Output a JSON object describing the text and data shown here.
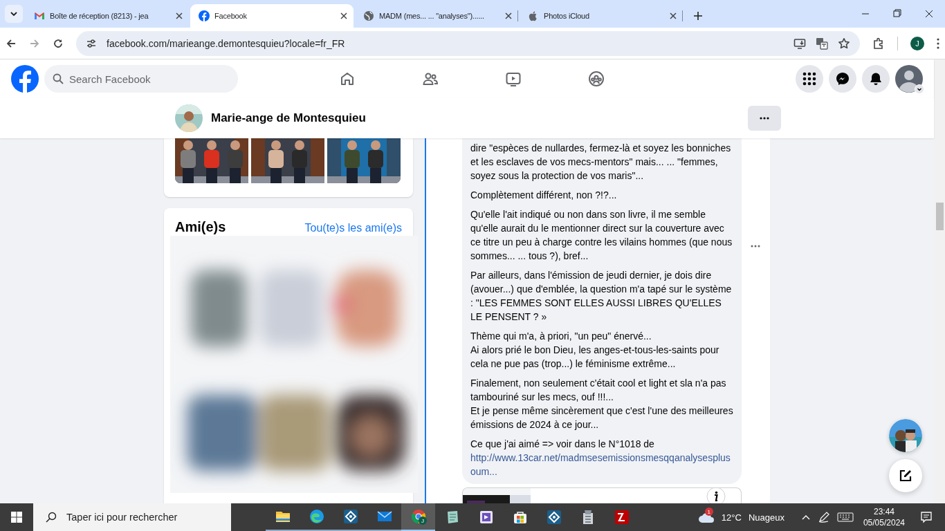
{
  "browser": {
    "tabs": [
      {
        "kind": "gmail",
        "title": "Boîte de réception (8213) - jea",
        "selected": false
      },
      {
        "kind": "facebook",
        "title": "Facebook",
        "selected": true
      },
      {
        "kind": "globe",
        "title": "MADM (mes... ... \"analyses\")......",
        "selected": false
      },
      {
        "kind": "apple",
        "title": "Photos iCloud",
        "selected": false
      }
    ],
    "url": "facebook.com/marieange.demontesquieu?locale=fr_FR",
    "profile_initial": "J"
  },
  "facebook": {
    "search_placeholder": "Search Facebook",
    "nav": [
      {
        "kind": "home"
      },
      {
        "kind": "friends"
      },
      {
        "kind": "video"
      },
      {
        "kind": "groups"
      }
    ]
  },
  "profile": {
    "name": "Marie-ange de Montesquieu"
  },
  "friends": {
    "title": "Ami(e)s",
    "link": "Tou(te)s les ami(e)s"
  },
  "comment": {
    "paragraphs": [
      "dire \"espèces de nullardes, fermez-là et soyez les bonniches et les esclaves de vos mecs-mentors\" mais... ... \"femmes, soyez sous la protection de vos maris\"...",
      "Complètement différent, non ?!?...",
      "Qu'elle l'ait indiqué ou non dans son livre, il me semble qu'elle aurait du le mentionner direct sur la couverture avec ce titre un peu à charge contre les vilains hommes (que nous sommes... ... tous ?), bref...",
      "Par ailleurs, dans l'émission de jeudi dernier, je dois dire (avouer...) que d'emblée, la question m'a tapé sur le système : \"LES FEMMES SONT ELLES AUSSI LIBRES QU'ELLES LE PENSENT ? »",
      "Thème qui m'a, à priori, \"un peu\" énervé...\nAi alors prié le bon Dieu, les anges-et-tous-les-saints pour cela ne pue pas (trop...) le féminisme extrême...",
      "Finalement, non seulement c'était cool et light et sla n'a pas tambouriné sur les mecs, ouf !!!...\nEt je pense même sincèrement que c'est l'une des meilleures émissions de 2024 à ce jour...",
      "Ce que j'ai aimé => voir dans le N°1018 de"
    ],
    "link": "http://www.13car.net/madmsesemissionsmesqqanalysesplusoum..."
  },
  "taskbar": {
    "search_placeholder": "Taper ici pour rechercher",
    "apps": [
      {
        "kind": "folder",
        "running": true,
        "selected": false
      },
      {
        "kind": "edge",
        "running": true,
        "selected": false
      },
      {
        "kind": "diamond",
        "running": true,
        "selected": false
      },
      {
        "kind": "mail",
        "running": true,
        "selected": false
      },
      {
        "kind": "chrome",
        "running": true,
        "selected": true,
        "badge": "J"
      },
      {
        "kind": "notepad",
        "running": false,
        "selected": false
      },
      {
        "kind": "studio",
        "running": false,
        "selected": false
      },
      {
        "kind": "store",
        "running": false,
        "selected": false
      },
      {
        "kind": "diamond",
        "running": false,
        "selected": false
      },
      {
        "kind": "files",
        "running": false,
        "selected": false
      },
      {
        "kind": "filezilla",
        "running": false,
        "selected": false
      }
    ],
    "weather": {
      "badge": "1",
      "temperature": "12°C",
      "condition": "Nuageux"
    },
    "time": "23:44",
    "date": "05/05/2024"
  }
}
